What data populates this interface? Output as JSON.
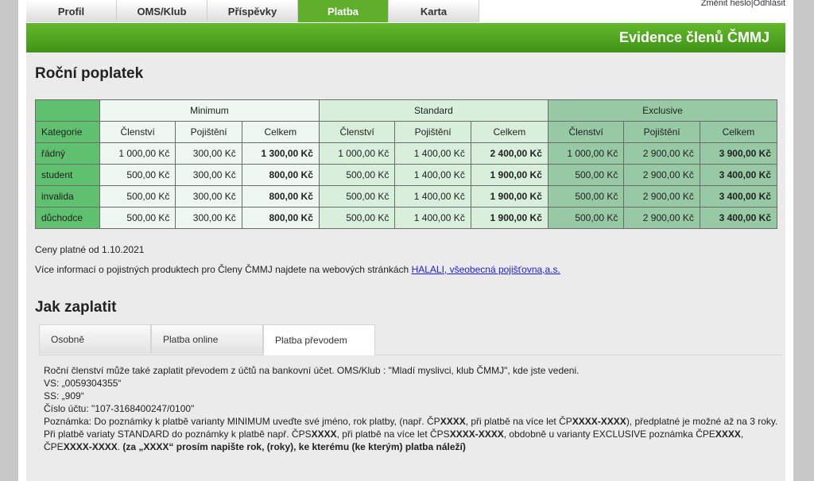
{
  "nav": {
    "tabs": [
      "Profil",
      "OMS/Klub",
      "Příspěvky",
      "Platba",
      "Karta"
    ],
    "active": "Platba"
  },
  "top_links": {
    "change_password": "Změnit heslo",
    "separator": "|",
    "logout": "Odhlásit"
  },
  "banner": {
    "title": "Evidence členů ČMMJ"
  },
  "annual": {
    "heading": "Roční poplatek",
    "groups": [
      "Minimum",
      "Standard",
      "Exclusive"
    ],
    "category_header": "Kategorie",
    "columns": [
      "Členství",
      "Pojištění",
      "Celkem",
      "Členství",
      "Pojištění",
      "Celkem",
      "Členství",
      "Pojištění",
      "Celkem"
    ],
    "rows": [
      {
        "cat": "řádný",
        "vals": [
          "1 000,00 Kč",
          "300,00 Kč",
          "1 300,00 Kč",
          "1 000,00 Kč",
          "1 400,00 Kč",
          "2 400,00 Kč",
          "1 000,00 Kč",
          "2 900,00 Kč",
          "3 900,00 Kč"
        ]
      },
      {
        "cat": "student",
        "vals": [
          "500,00 Kč",
          "300,00 Kč",
          "800,00 Kč",
          "500,00 Kč",
          "1 400,00 Kč",
          "1 900,00 Kč",
          "500,00 Kč",
          "2 900,00 Kč",
          "3 400,00 Kč"
        ]
      },
      {
        "cat": "invalida",
        "vals": [
          "500,00 Kč",
          "300,00 Kč",
          "800,00 Kč",
          "500,00 Kč",
          "1 400,00 Kč",
          "1 900,00 Kč",
          "500,00 Kč",
          "2 900,00 Kč",
          "3 400,00 Kč"
        ]
      },
      {
        "cat": "důchodce",
        "vals": [
          "500,00 Kč",
          "300,00 Kč",
          "800,00 Kč",
          "500,00 Kč",
          "1 400,00 Kč",
          "1 900,00 Kč",
          "500,00 Kč",
          "2 900,00 Kč",
          "3 400,00 Kč"
        ]
      }
    ],
    "valid_from": "Ceny platné od 1.10.2021",
    "info_text": "Více informací o pojistných produktech pro Členy ČMMJ najdete na webových stránkách ",
    "info_link": "HALALI, všeobecná pojišťovna,a.s."
  },
  "pay": {
    "heading": "Jak zaplatit",
    "tabs": [
      "Osobně",
      "Platba online",
      "Platba převodem"
    ],
    "active_tab": "Platba převodem",
    "lines": {
      "l1": "Roční členství může také zaplatit převodem z účtů na bankovní účet. OMS/Klub : \"Mladí myslivci, klub ČMMJ\", kde jste vedeni.",
      "l2": "VS: „0059304355“",
      "l3": "SS: „909“",
      "l4": "Číslo účtu: \"107-3168400247/0100\"",
      "l5a": "Poznámka: Do poznámky k platbě varianty MINIMUM uveďte své jméno, rok platby, (např. ČP",
      "l5b": "XXXX",
      "l5c": ", při platbě na více let ČP",
      "l5d": "XXXX-XXXX",
      "l5e": "), předplatné je možné až na 3 roky.",
      "l6a": "Při platbě variaty STANDARD do poznámky k platbě např. ČPS",
      "l6b": "XXXX",
      "l6c": ", při platbě na více let ČPS",
      "l6d": "XXXX-XXXX",
      "l6e": ", obdobně u varianty EXCLUSIVE poznámka ČPE",
      "l6f": "XXXX",
      "l6g": ",",
      "l7a": "ČPE",
      "l7b": "XXXX-XXXX",
      "l7c": ". ",
      "l7d": "(za „XXXX“ prosím napište rok, (roky), ke kterému (ke kterým) platba náleží)"
    }
  }
}
